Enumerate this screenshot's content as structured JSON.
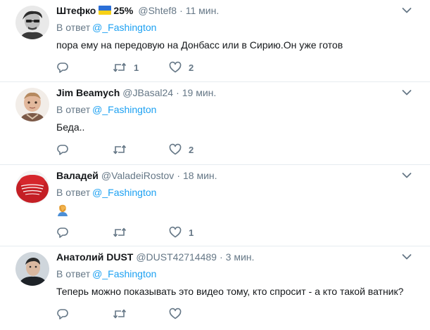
{
  "reply_prefix": "В ответ",
  "colors": {
    "link": "#1da1f2",
    "muted": "#657786",
    "text": "#14171a",
    "divider": "#e6ecf0"
  },
  "tweets": [
    {
      "name": "Штефко",
      "badge_icon": "ukraine-flag-icon",
      "percent": "25%",
      "handle": "@Shtef8",
      "dot": "·",
      "time": "11 мин.",
      "reply_to": "@_Fashington",
      "text": "пора ему на передовую на Донбасс или в Сирию.Он уже готов",
      "retweets": "1",
      "likes": "2"
    },
    {
      "name": "Jim Beamych",
      "handle": "@JBasal24",
      "dot": "·",
      "time": "19 мин.",
      "reply_to": "@_Fashington",
      "text": "Беда..",
      "retweets": "",
      "likes": "2"
    },
    {
      "name": "Валадей",
      "handle": "@ValadeiRostov",
      "dot": "·",
      "time": "18 мин.",
      "reply_to": "@_Fashington",
      "text": "🤦",
      "text_icon": "facepalm-emoji-icon",
      "retweets": "",
      "likes": "1"
    },
    {
      "name": "Анатолий DUST",
      "handle": "@DUST42714489",
      "dot": "·",
      "time": "3 мин.",
      "reply_to": "@_Fashington",
      "text": "Теперь можно показывать это видео тому, кто спросит - а кто такой ватник?",
      "retweets": "",
      "likes": ""
    }
  ]
}
